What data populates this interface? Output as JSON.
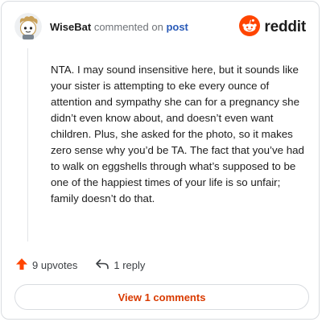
{
  "header": {
    "username": "WiseBat",
    "action_text": "commented on",
    "post_link": "post",
    "avatar_icon": "snoo-avatar-icon",
    "brand_icon": "reddit-logo-icon",
    "brand_text": "reddit"
  },
  "comment": {
    "body": "NTA. I may sound insensitive here, but it sounds like your sister is attempting to eke every ounce of attention and sympathy she can for a pregnancy she didn’t even know about, and doesn’t even want children. Plus, she asked for the photo, so it makes zero sense why you’d be TA. The fact that you’ve had to walk on eggshells through what’s supposed to be one of the happiest times of your life is so unfair; family doesn’t do that."
  },
  "actions": {
    "upvote_icon": "upvote-arrow-icon",
    "upvotes_label": "9 upvotes",
    "reply_icon": "reply-arrow-icon",
    "reply_label": "1 reply"
  },
  "footer": {
    "view_comments_label": "View 1 comments"
  },
  "colors": {
    "accent": "#d93a00",
    "upvote": "#ff4500",
    "link": "#2a5bb8",
    "border": "#d9dce0"
  }
}
